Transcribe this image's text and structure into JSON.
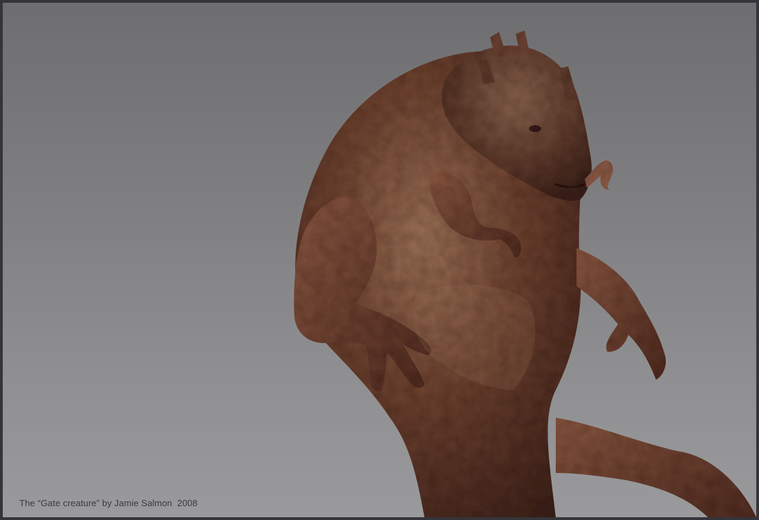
{
  "caption": "The “Gate creature” by Jamie Salmon  2008",
  "colors": {
    "background_top": "#6e6e70",
    "background_bottom": "#9a9a9c",
    "frame": "#35343a",
    "skin_dark": "#4a2c22",
    "skin_mid": "#7a4a36",
    "skin_light": "#a67a60",
    "caption_text": "#3a3a3c"
  }
}
